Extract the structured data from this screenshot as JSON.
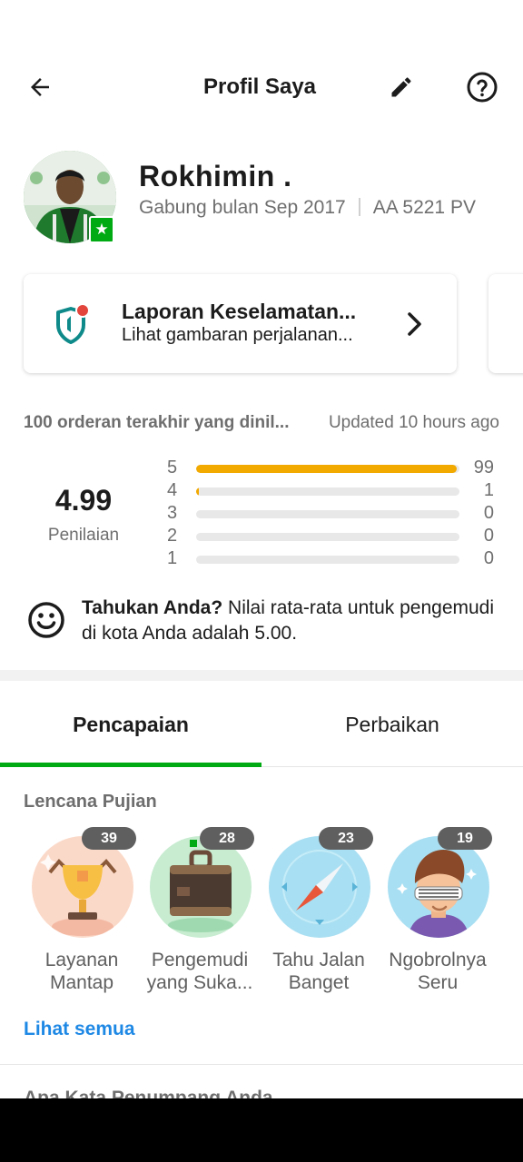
{
  "header": {
    "title": "Profil Saya"
  },
  "profile": {
    "name": "Rokhimin .",
    "joined": "Gabung bulan Sep 2017",
    "plate": "AA 5221 PV",
    "badge_icon": "star-icon"
  },
  "safety_card": {
    "title": "Laporan Keselamatan...",
    "subtitle": "Lihat gambaran perjalanan...",
    "icon": "shield-icon",
    "accent_color": "#e2453c"
  },
  "rating": {
    "orders_label": "100 orderan terakhir yang dinil...",
    "updated": "Updated 10 hours ago",
    "value": "4.99",
    "caption": "Penilaian",
    "breakdown": [
      {
        "stars": "5",
        "count": "99",
        "share": 0.99
      },
      {
        "stars": "4",
        "count": "1",
        "share": 0.01
      },
      {
        "stars": "3",
        "count": "0",
        "share": 0
      },
      {
        "stars": "2",
        "count": "0",
        "share": 0
      },
      {
        "stars": "1",
        "count": "0",
        "share": 0
      }
    ],
    "bar_color": "#f2a900"
  },
  "tip": {
    "bold": "Tahukan Anda?",
    "text": " Nilai rata-rata untuk pengemudi di kota Anda adalah 5.00."
  },
  "tabs": [
    {
      "label": "Pencapaian",
      "active": true
    },
    {
      "label": "Perbaikan",
      "active": false
    }
  ],
  "badges": {
    "section_label": "Lencana Pujian",
    "items": [
      {
        "label": "Layanan Mantap",
        "count": "39",
        "icon": "trophy-icon"
      },
      {
        "label": "Pengemudi yang Suka...",
        "count": "28",
        "icon": "suitcase-icon"
      },
      {
        "label": "Tahu Jalan Banget",
        "count": "23",
        "icon": "compass-icon"
      },
      {
        "label": "Ngobrolnya Seru",
        "count": "19",
        "icon": "cool-guy-icon"
      }
    ],
    "see_all": "Lihat semua"
  },
  "next_section_peek": "Apa Kata Penumpang Anda",
  "colors": {
    "brand_green": "#00aa13",
    "link_blue": "#1e88e5"
  }
}
